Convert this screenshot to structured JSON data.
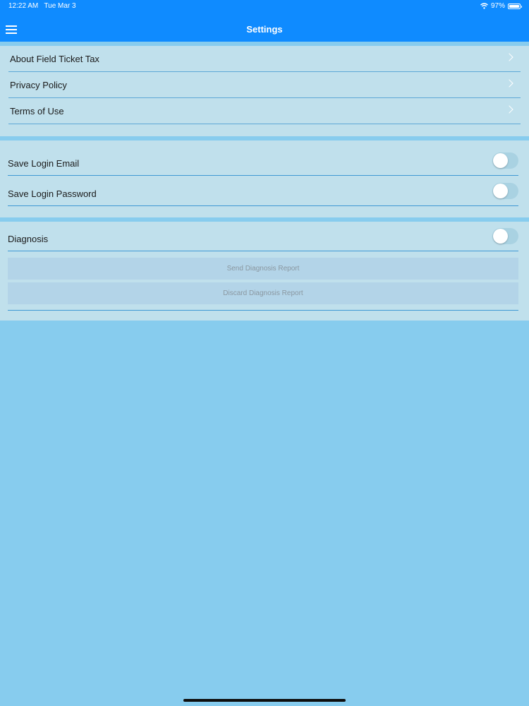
{
  "status_bar": {
    "time": "12:22 AM",
    "date": "Tue Mar 3",
    "battery": "97%",
    "battery_level": 0.97,
    "wifi_icon": "wifi-icon"
  },
  "nav": {
    "title": "Settings",
    "menu_icon": "hamburger-menu-icon"
  },
  "info_links": [
    {
      "label": "About Field Ticket Tax",
      "icon": "chevron-right-icon"
    },
    {
      "label": "Privacy Policy",
      "icon": "chevron-right-icon"
    },
    {
      "label": "Terms of Use",
      "icon": "chevron-right-icon"
    }
  ],
  "login_settings": [
    {
      "label": "Save Login Email",
      "enabled": false
    },
    {
      "label": "Save Login Password",
      "enabled": false
    }
  ],
  "diagnosis": {
    "label": "Diagnosis",
    "enabled": false,
    "send_label": "Send Diagnosis Report",
    "discard_label": "Discard Diagnosis Report"
  },
  "colors": {
    "nav_bar": "#0f8bff",
    "background": "#87ccee",
    "section_bg": "#c0e0ec",
    "separator": "#3f98d4"
  }
}
